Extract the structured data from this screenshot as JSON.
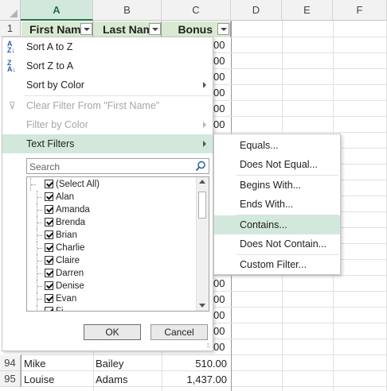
{
  "columns": [
    "A",
    "B",
    "C",
    "D",
    "E",
    "F"
  ],
  "rows": [
    {
      "num": "1"
    },
    {
      "num": "94",
      "first": "Mike",
      "last": "Bailey",
      "bonus": "510.00"
    },
    {
      "num": "95",
      "first": "Louise",
      "last": "Adams",
      "bonus": "1,437.00"
    }
  ],
  "headers": {
    "first": "First Name",
    "last": "Last Name",
    "bonus": "Bonus"
  },
  "bonus_partial": [
    "00",
    "00",
    "00",
    "00",
    "00",
    "00",
    "00",
    "00",
    "00",
    "00",
    "00",
    "00"
  ],
  "menu": {
    "sort_az": "Sort A to Z",
    "sort_za": "Sort Z to A",
    "sort_color": "Sort by Color",
    "clear_filter": "Clear Filter From \"First Name\"",
    "filter_color": "Filter by Color",
    "text_filters": "Text Filters",
    "search_placeholder": "Search",
    "list": [
      "(Select All)",
      "Alan",
      "Amanda",
      "Brenda",
      "Brian",
      "Charlie",
      "Claire",
      "Darren",
      "Denise",
      "Evan",
      "Fi"
    ],
    "ok": "OK",
    "cancel": "Cancel"
  },
  "submenu": [
    "Equals...",
    "Does Not Equal...",
    "Begins With...",
    "Ends With...",
    "Contains...",
    "Does Not Contain...",
    "Custom Filter..."
  ],
  "colors": {
    "accent": "#217346",
    "highlight": "#d3e8dc",
    "header_fill": "#d9ead3"
  }
}
